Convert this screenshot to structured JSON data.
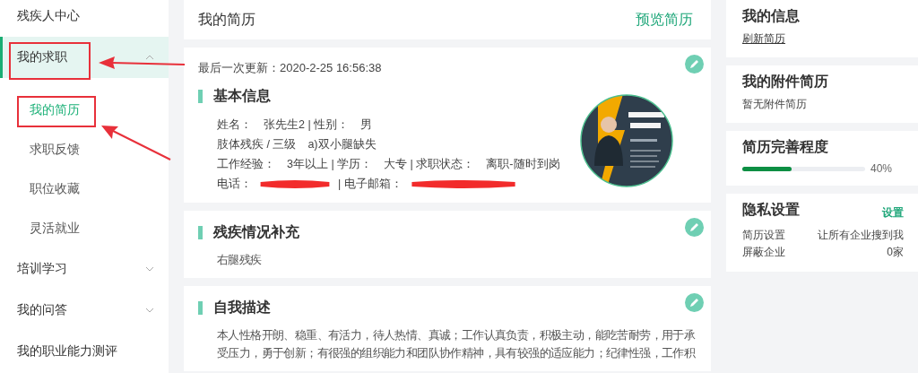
{
  "sidebar": {
    "items": [
      {
        "label": "残疾人中心",
        "selected": false
      },
      {
        "label": "我的求职",
        "selected": true,
        "expanded": true,
        "children": [
          {
            "label": "我的简历",
            "selected": true
          },
          {
            "label": "求职反馈",
            "selected": false
          },
          {
            "label": "职位收藏",
            "selected": false
          },
          {
            "label": "灵活就业",
            "selected": false
          }
        ]
      },
      {
        "label": "培训学习",
        "selected": false,
        "expanded": false
      },
      {
        "label": "我的问答",
        "selected": false,
        "expanded": false
      },
      {
        "label": "我的职业能力测评",
        "selected": false
      }
    ]
  },
  "header": {
    "title": "我的简历",
    "action": "预览简历"
  },
  "basic": {
    "updated": "最后一次更新：2020-2-25 16:56:38",
    "title": "基本信息",
    "rows": [
      {
        "kind": "text",
        "text": "姓名：　张先生2 | 性别：　男"
      },
      {
        "kind": "text",
        "text": "肢体残疾 / 三级　a)双小腿缺失"
      },
      {
        "kind": "text",
        "text": "工作经验：　3年以上 | 学历：　大专 | 求职状态：　离职-随时到岗"
      },
      {
        "kind": "redacted",
        "labels": [
          "电话：",
          "| 电子邮箱："
        ]
      }
    ]
  },
  "disability": {
    "title": "残疾情况补充",
    "text": "右腿残疾"
  },
  "self": {
    "title": "自我描述",
    "text": "本人性格开朗、稳重、有活力，待人热情、真诚；工作认真负责，积极主动，能吃苦耐劳，用于承受压力，勇于创新；有很强的组织能力和团队协作精神，具有较强的适应能力；纪律性强，工作积"
  },
  "info": {
    "title": "我的信息",
    "link": "刷新简历"
  },
  "attachment": {
    "title": "我的附件简历",
    "text": "暂无附件简历"
  },
  "completeness": {
    "title": "简历完善程度",
    "level": 0.4,
    "reading": "40%"
  },
  "privacy": {
    "title": "隐私设置",
    "action": "设置",
    "rows": [
      {
        "label": "简历设置",
        "value": "让所有企业搜到我"
      },
      {
        "label": "屏蔽企业",
        "value": "0家"
      }
    ]
  }
}
